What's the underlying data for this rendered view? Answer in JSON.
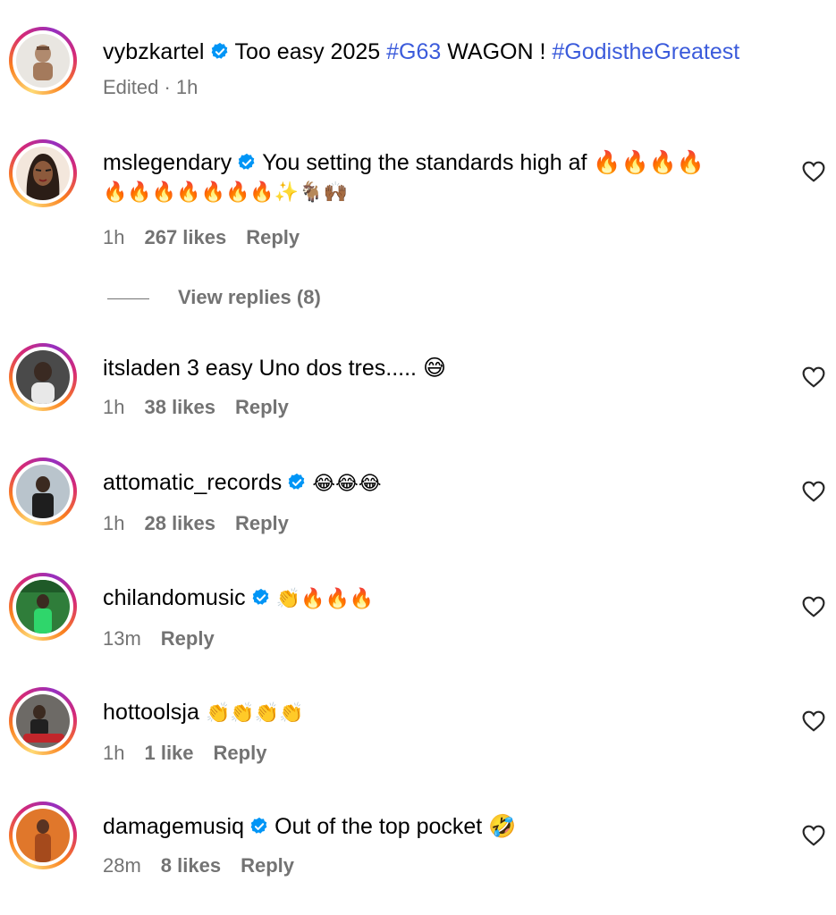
{
  "post": {
    "username": "vybzkartel",
    "caption_parts": [
      "Too easy 2025 ",
      "#G63",
      " WAGON ! ",
      "#GodistheGreatest"
    ],
    "meta_edited": "Edited · 1h"
  },
  "comments": [
    {
      "username": "mslegendary",
      "verified": true,
      "text_line1": "You setting the standards high af 🔥🔥🔥🔥",
      "text_line2": "🔥🔥🔥🔥🔥🔥🔥✨🐐🙌🏾",
      "time": "1h",
      "likes": "267 likes",
      "reply": "Reply",
      "view_replies": "View replies (8)"
    },
    {
      "username": "itsladen",
      "verified": false,
      "text_line1": "3 easy Uno dos tres..... 😅",
      "time": "1h",
      "likes": "38 likes",
      "reply": "Reply"
    },
    {
      "username": "attomatic_records",
      "verified": true,
      "text_line1": "😂😂😂",
      "time": "1h",
      "likes": "28 likes",
      "reply": "Reply"
    },
    {
      "username": "chilandomusic",
      "verified": true,
      "text_line1": "👏🔥🔥🔥",
      "time": "13m",
      "likes": "",
      "reply": "Reply"
    },
    {
      "username": "hottoolsja",
      "verified": false,
      "text_line1": "👏👏👏👏",
      "time": "1h",
      "likes": "1 like",
      "reply": "Reply"
    },
    {
      "username": "damagemusiq",
      "verified": true,
      "text_line1": "Out of the top pocket 🤣",
      "time": "28m",
      "likes": "8 likes",
      "reply": "Reply"
    }
  ],
  "colors": {
    "hashtag": "#3b5bdb",
    "meta": "#737373",
    "verified": "#0095f6"
  }
}
